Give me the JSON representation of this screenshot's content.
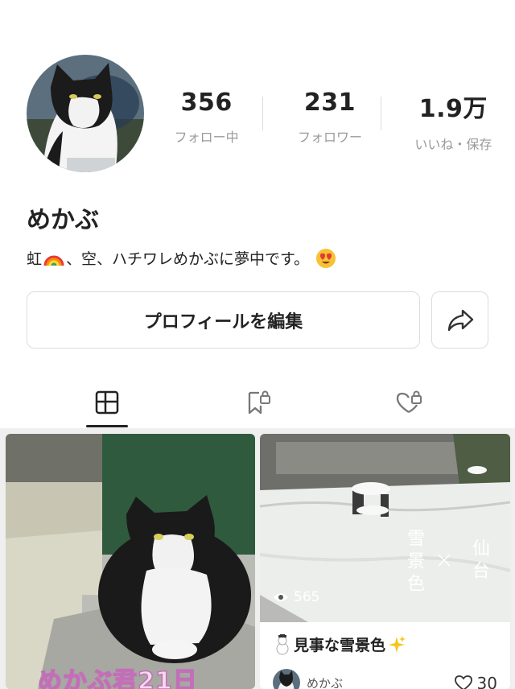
{
  "profile": {
    "username": "めかぶ",
    "bio_text": "虹",
    "bio_text2": "、空、ハチワレめかぶに夢中です。",
    "stats": [
      {
        "value": "356",
        "label": "フォロー中"
      },
      {
        "value": "231",
        "label": "フォロワー"
      },
      {
        "value": "1.9万",
        "label": "いいね・保存"
      }
    ]
  },
  "actions": {
    "edit_label": "プロフィールを編集"
  },
  "tabs": [
    "posts-grid-icon",
    "saved-lock-icon",
    "liked-lock-icon"
  ],
  "posts": [
    {
      "caption": "めかぶ君21日"
    },
    {
      "views": "565",
      "overlay_left": "雪景色",
      "overlay_right": "仙台",
      "overlay_x": "×",
      "title": "見事な雪景色",
      "author": "めかぶ",
      "likes": "30"
    }
  ],
  "colors": {
    "text": "#222222",
    "muted": "#9a9a9a",
    "border": "#dcdcdc"
  }
}
